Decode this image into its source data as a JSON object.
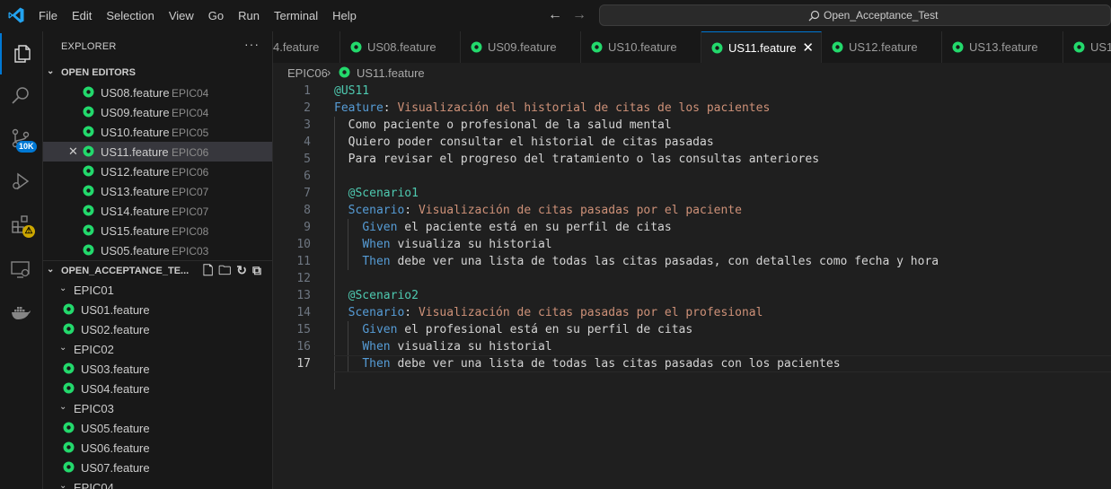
{
  "menu": [
    "File",
    "Edit",
    "Selection",
    "View",
    "Go",
    "Run",
    "Terminal",
    "Help"
  ],
  "command_center": {
    "text": "Open_Acceptance_Test"
  },
  "activity": {
    "source_control_badge": "10K",
    "extensions_badge": "⚠"
  },
  "explorer": {
    "title": "EXPLORER",
    "more": "···",
    "open_editors_label": "OPEN EDITORS",
    "open_editors": [
      {
        "name": "US08.feature",
        "desc": "EPIC04"
      },
      {
        "name": "US09.feature",
        "desc": "EPIC04"
      },
      {
        "name": "US10.feature",
        "desc": "EPIC05"
      },
      {
        "name": "US11.feature",
        "desc": "EPIC06"
      },
      {
        "name": "US12.feature",
        "desc": "EPIC06"
      },
      {
        "name": "US13.feature",
        "desc": "EPIC07"
      },
      {
        "name": "US14.feature",
        "desc": "EPIC07"
      },
      {
        "name": "US15.feature",
        "desc": "EPIC08"
      },
      {
        "name": "US05.feature",
        "desc": "EPIC03"
      }
    ],
    "project_label": "OPEN_ACCEPTANCE_TE...",
    "tree": [
      {
        "folder": "EPIC01"
      },
      {
        "file": "US01.feature"
      },
      {
        "file": "US02.feature"
      },
      {
        "folder": "EPIC02"
      },
      {
        "file": "US03.feature"
      },
      {
        "file": "US04.feature"
      },
      {
        "folder": "EPIC03"
      },
      {
        "file": "US05.feature"
      },
      {
        "file": "US06.feature"
      },
      {
        "file": "US07.feature"
      },
      {
        "folder": "EPIC04"
      }
    ]
  },
  "tabs": [
    "4.feature",
    "US08.feature",
    "US09.feature",
    "US10.feature",
    "US11.feature",
    "US12.feature",
    "US13.feature",
    "US1"
  ],
  "active_tab": "US11.feature",
  "breadcrumb": {
    "folder": "EPIC06",
    "file": "US11.feature"
  },
  "editor": {
    "lines": [
      {
        "n": "1",
        "tokens": [
          {
            "t": "@US11",
            "c": "teal"
          }
        ]
      },
      {
        "n": "2",
        "tokens": [
          {
            "t": "Feature",
            "c": "blue"
          },
          {
            "t": ": ",
            "c": "plain"
          },
          {
            "t": "Visualización del historial de citas de los pacientes",
            "c": "orange"
          }
        ]
      },
      {
        "n": "3",
        "tokens": [
          {
            "t": "  Como paciente o profesional de la salud mental",
            "c": "plain"
          }
        ]
      },
      {
        "n": "4",
        "tokens": [
          {
            "t": "  Quiero poder consultar el historial de citas pasadas",
            "c": "plain"
          }
        ]
      },
      {
        "n": "5",
        "tokens": [
          {
            "t": "  Para revisar el progreso del tratamiento o las consultas anteriores",
            "c": "plain"
          }
        ]
      },
      {
        "n": "6",
        "tokens": []
      },
      {
        "n": "7",
        "tokens": [
          {
            "t": "  ",
            "c": "plain"
          },
          {
            "t": "@Scenario1",
            "c": "teal"
          }
        ]
      },
      {
        "n": "8",
        "tokens": [
          {
            "t": "  ",
            "c": "plain"
          },
          {
            "t": "Scenario",
            "c": "blue"
          },
          {
            "t": ": ",
            "c": "plain"
          },
          {
            "t": "Visualización de citas pasadas por el paciente",
            "c": "orange"
          }
        ]
      },
      {
        "n": "9",
        "tokens": [
          {
            "t": "    ",
            "c": "plain"
          },
          {
            "t": "Given",
            "c": "blue"
          },
          {
            "t": " el paciente está en su perfil de citas",
            "c": "plain"
          }
        ]
      },
      {
        "n": "10",
        "tokens": [
          {
            "t": "    ",
            "c": "plain"
          },
          {
            "t": "When",
            "c": "blue"
          },
          {
            "t": " visualiza su historial",
            "c": "plain"
          }
        ]
      },
      {
        "n": "11",
        "tokens": [
          {
            "t": "    ",
            "c": "plain"
          },
          {
            "t": "Then",
            "c": "blue"
          },
          {
            "t": " debe ver una lista de todas las citas pasadas, con detalles como fecha y hora",
            "c": "plain"
          }
        ]
      },
      {
        "n": "12",
        "tokens": []
      },
      {
        "n": "13",
        "tokens": [
          {
            "t": "  ",
            "c": "plain"
          },
          {
            "t": "@Scenario2",
            "c": "teal"
          }
        ]
      },
      {
        "n": "14",
        "tokens": [
          {
            "t": "  ",
            "c": "plain"
          },
          {
            "t": "Scenario",
            "c": "blue"
          },
          {
            "t": ": ",
            "c": "plain"
          },
          {
            "t": "Visualización de citas pasadas por el profesional",
            "c": "orange"
          }
        ]
      },
      {
        "n": "15",
        "tokens": [
          {
            "t": "    ",
            "c": "plain"
          },
          {
            "t": "Given",
            "c": "blue"
          },
          {
            "t": " el profesional está en su perfil de citas",
            "c": "plain"
          }
        ]
      },
      {
        "n": "16",
        "tokens": [
          {
            "t": "    ",
            "c": "plain"
          },
          {
            "t": "When",
            "c": "blue"
          },
          {
            "t": " visualiza su historial",
            "c": "plain"
          }
        ]
      },
      {
        "n": "17",
        "tokens": [
          {
            "t": "    ",
            "c": "plain"
          },
          {
            "t": "Then",
            "c": "blue"
          },
          {
            "t": " debe ver una lista de todas las citas pasadas con los pacientes",
            "c": "plain"
          }
        ]
      }
    ],
    "current_line": "17"
  },
  "colors": {
    "accent": "#0078d4",
    "cucumber_icon": "#23d96c"
  }
}
